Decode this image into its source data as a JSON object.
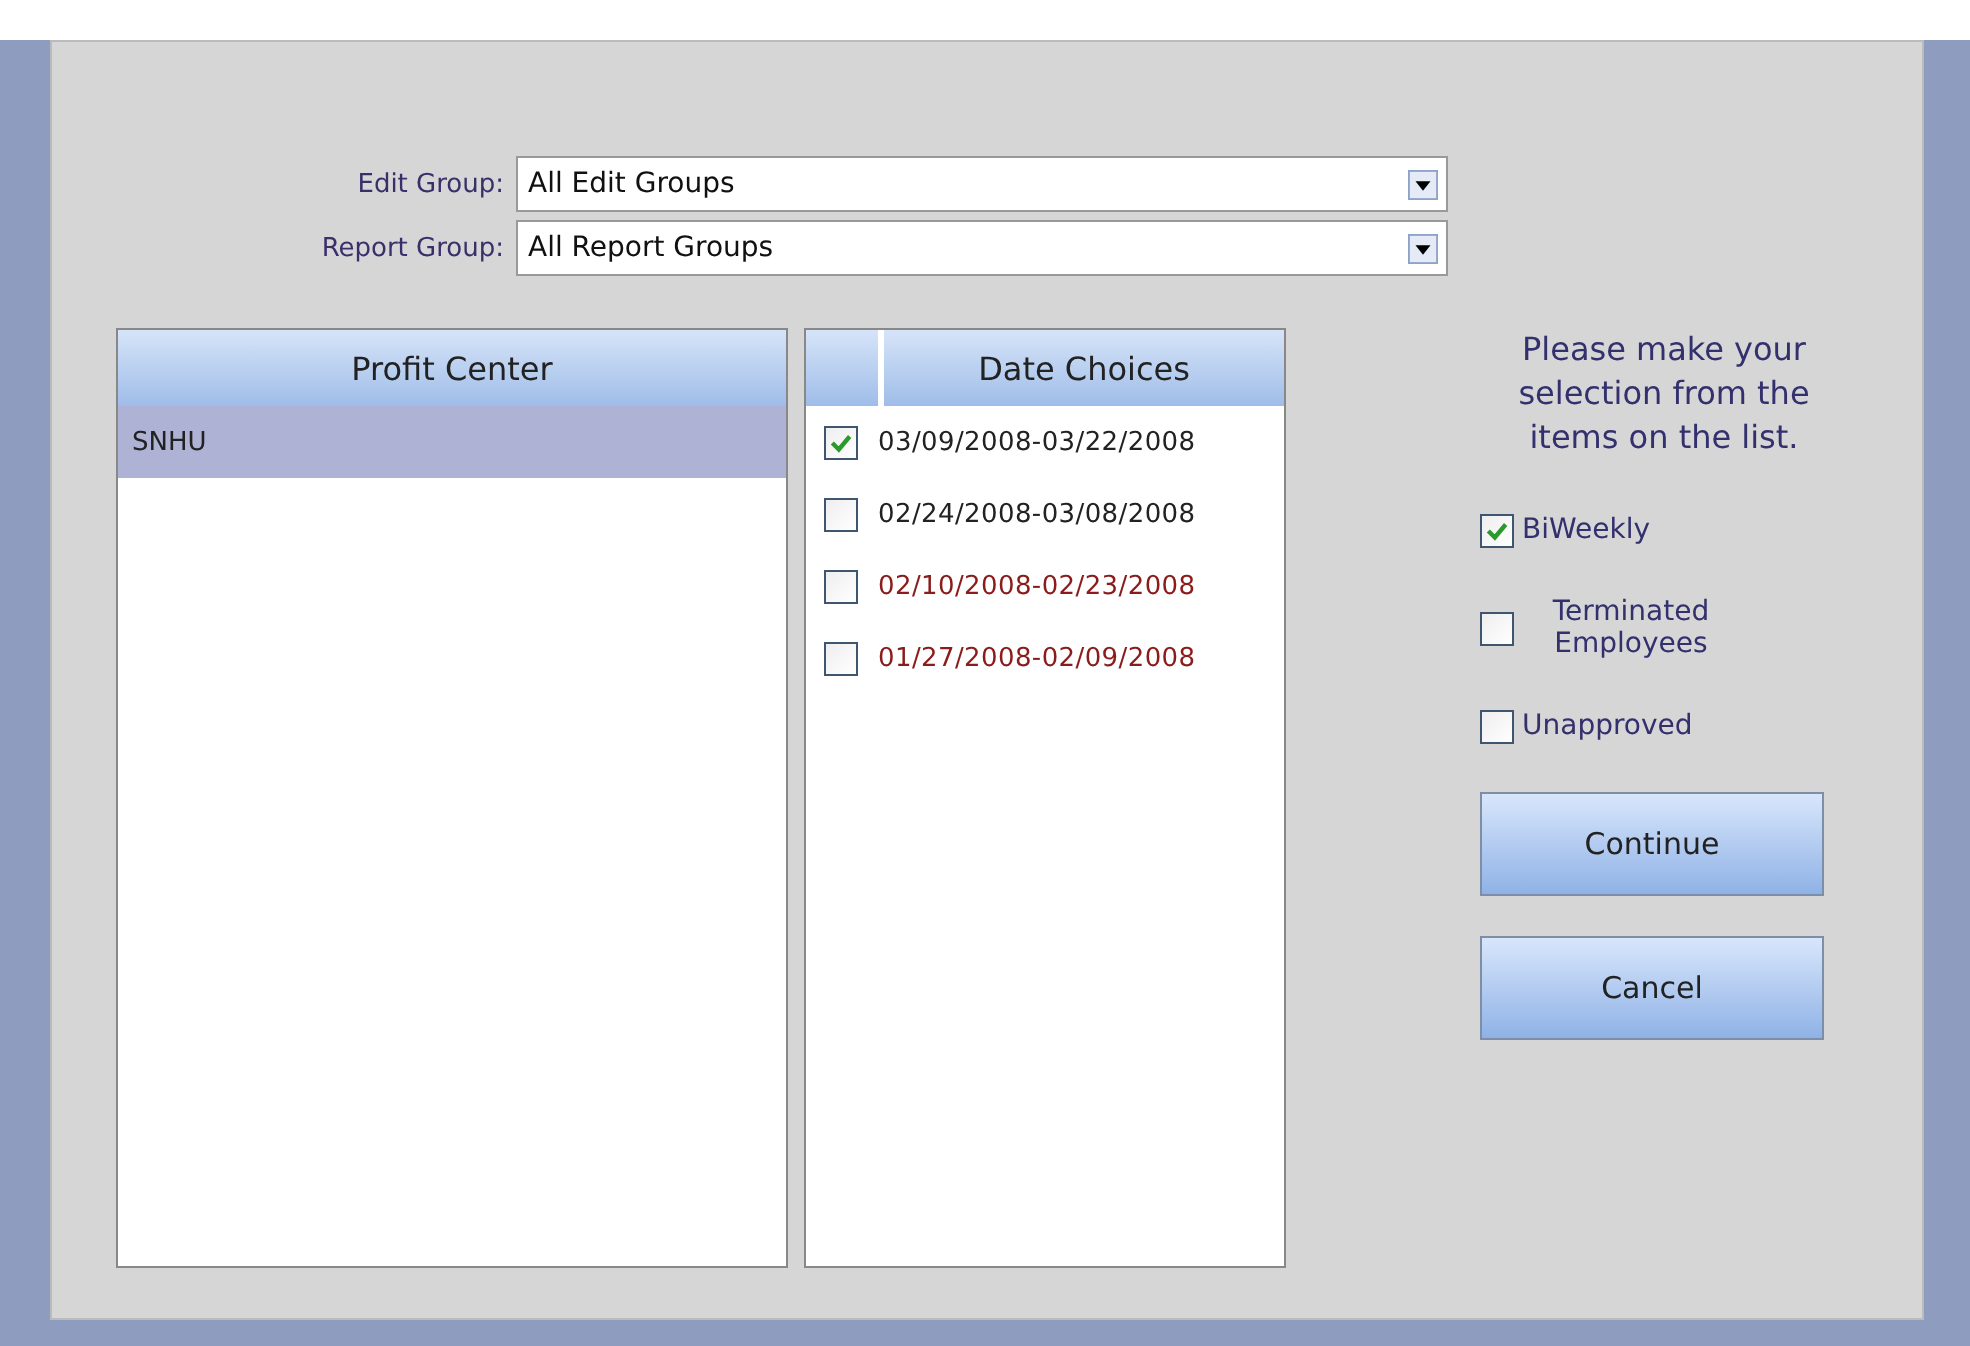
{
  "edit_group": {
    "label": "Edit Group:",
    "value": "All Edit Groups"
  },
  "report_group": {
    "label": "Report Group:",
    "value": "All Report Groups"
  },
  "profit_center": {
    "heading": "Profit Center",
    "items": [
      {
        "label": "SNHU",
        "selected": true
      }
    ]
  },
  "date_choices": {
    "heading": "Date Choices",
    "items": [
      {
        "label": "03/09/2008-03/22/2008",
        "checked": true,
        "color": "#222222"
      },
      {
        "label": "02/24/2008-03/08/2008",
        "checked": false,
        "color": "#222222"
      },
      {
        "label": "02/10/2008-02/23/2008",
        "checked": false,
        "color": "#8b1c1c"
      },
      {
        "label": "01/27/2008-02/09/2008",
        "checked": false,
        "color": "#8b1c1c"
      }
    ]
  },
  "instructions": "Please make your selection from the items on the list.",
  "options": [
    {
      "label": "BiWeekly",
      "checked": true
    },
    {
      "label": "Terminated Employees",
      "checked": false
    },
    {
      "label": "Unapproved",
      "checked": false
    }
  ],
  "buttons": [
    "Continue",
    "Cancel"
  ]
}
